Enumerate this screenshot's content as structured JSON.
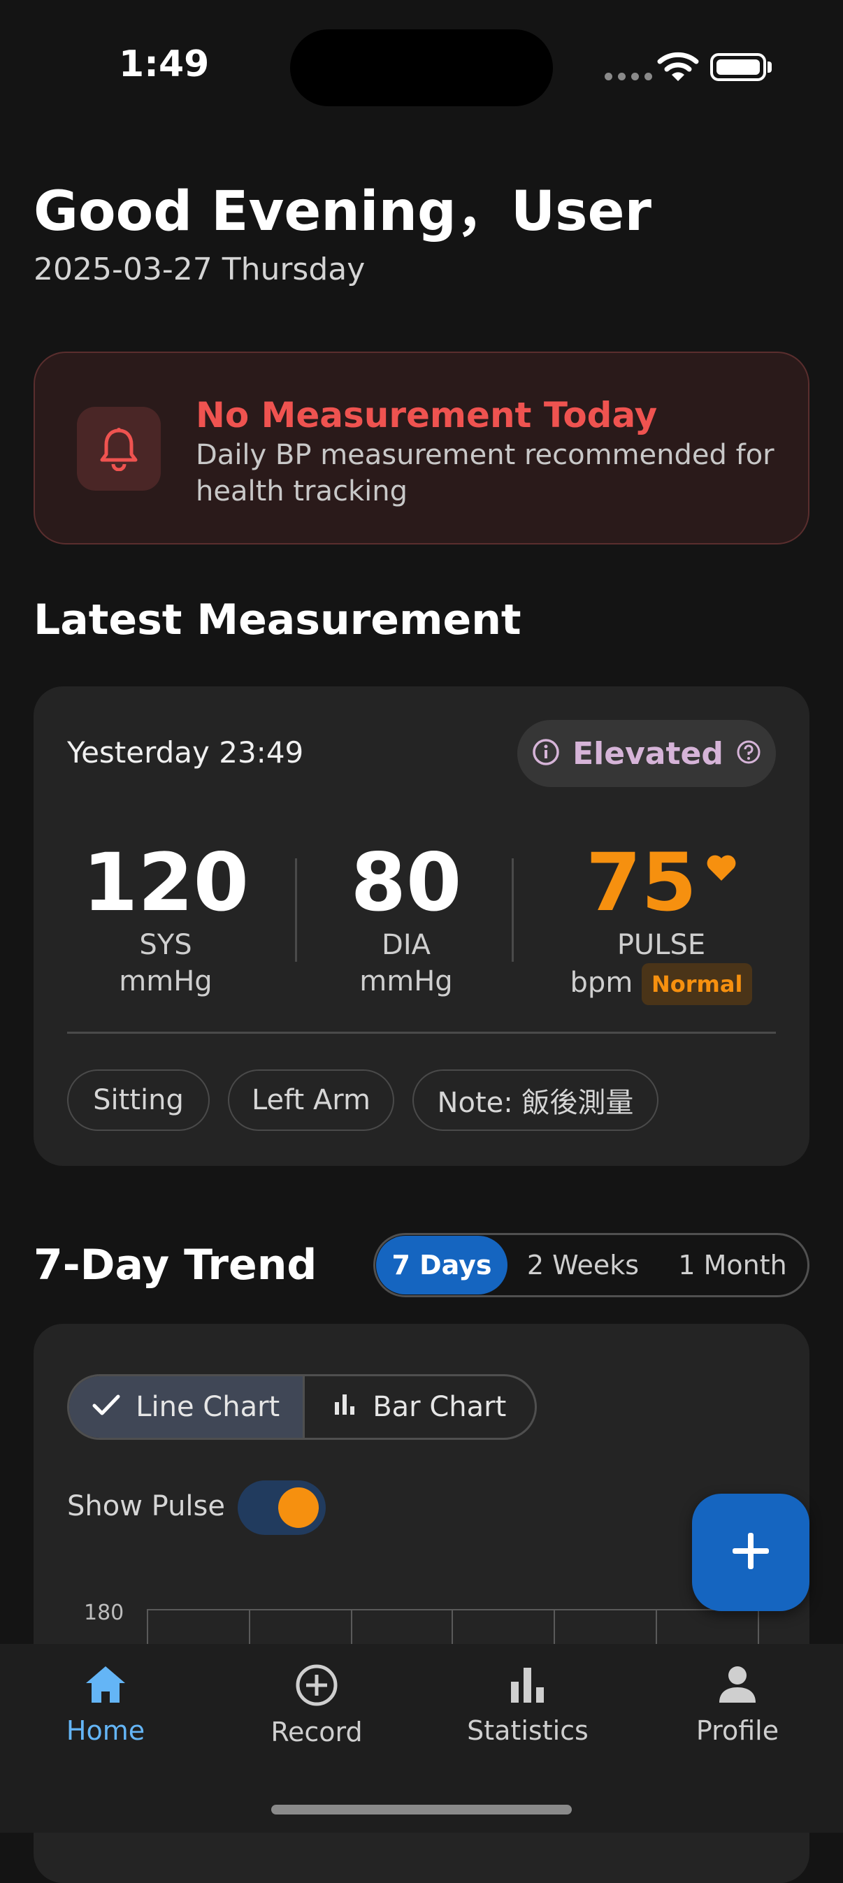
{
  "status_bar": {
    "time": "1:49"
  },
  "header": {
    "greeting": "Good Evening，User",
    "date": "2025-03-27 Thursday"
  },
  "alert": {
    "title": "No Measurement Today",
    "message": "Daily BP measurement recommended for health tracking",
    "icon": "bell-icon",
    "color": "#ef5350"
  },
  "latest": {
    "section_title": "Latest Measurement",
    "time": "Yesterday 23:49",
    "status": "Elevated",
    "sys": {
      "value": "120",
      "label": "SYS",
      "unit": "mmHg"
    },
    "dia": {
      "value": "80",
      "label": "DIA",
      "unit": "mmHg"
    },
    "pulse": {
      "value": "75",
      "label": "PULSE",
      "unit": "bpm",
      "status": "Normal"
    },
    "tags": [
      "Sitting",
      "Left Arm",
      "Note: 飯後測量"
    ]
  },
  "trend": {
    "section_title": "7-Day Trend",
    "ranges": [
      "7 Days",
      "2 Weeks",
      "1 Month"
    ],
    "selected_range": "7 Days",
    "chart_types": [
      "Line Chart",
      "Bar Chart"
    ],
    "selected_chart_type": "Line Chart",
    "show_pulse_label": "Show Pulse",
    "show_pulse": true,
    "y_top_tick": "180"
  },
  "nav": [
    {
      "label": "Home",
      "icon": "home-icon",
      "active": true
    },
    {
      "label": "Record",
      "icon": "add-circle-icon",
      "active": false
    },
    {
      "label": "Statistics",
      "icon": "bar-chart-icon",
      "active": false
    },
    {
      "label": "Profile",
      "icon": "person-icon",
      "active": false
    }
  ],
  "colors": {
    "accent": "#1565c0",
    "pulse": "#f6900f",
    "alert": "#ef5350",
    "active_nav": "#64b5f6"
  }
}
